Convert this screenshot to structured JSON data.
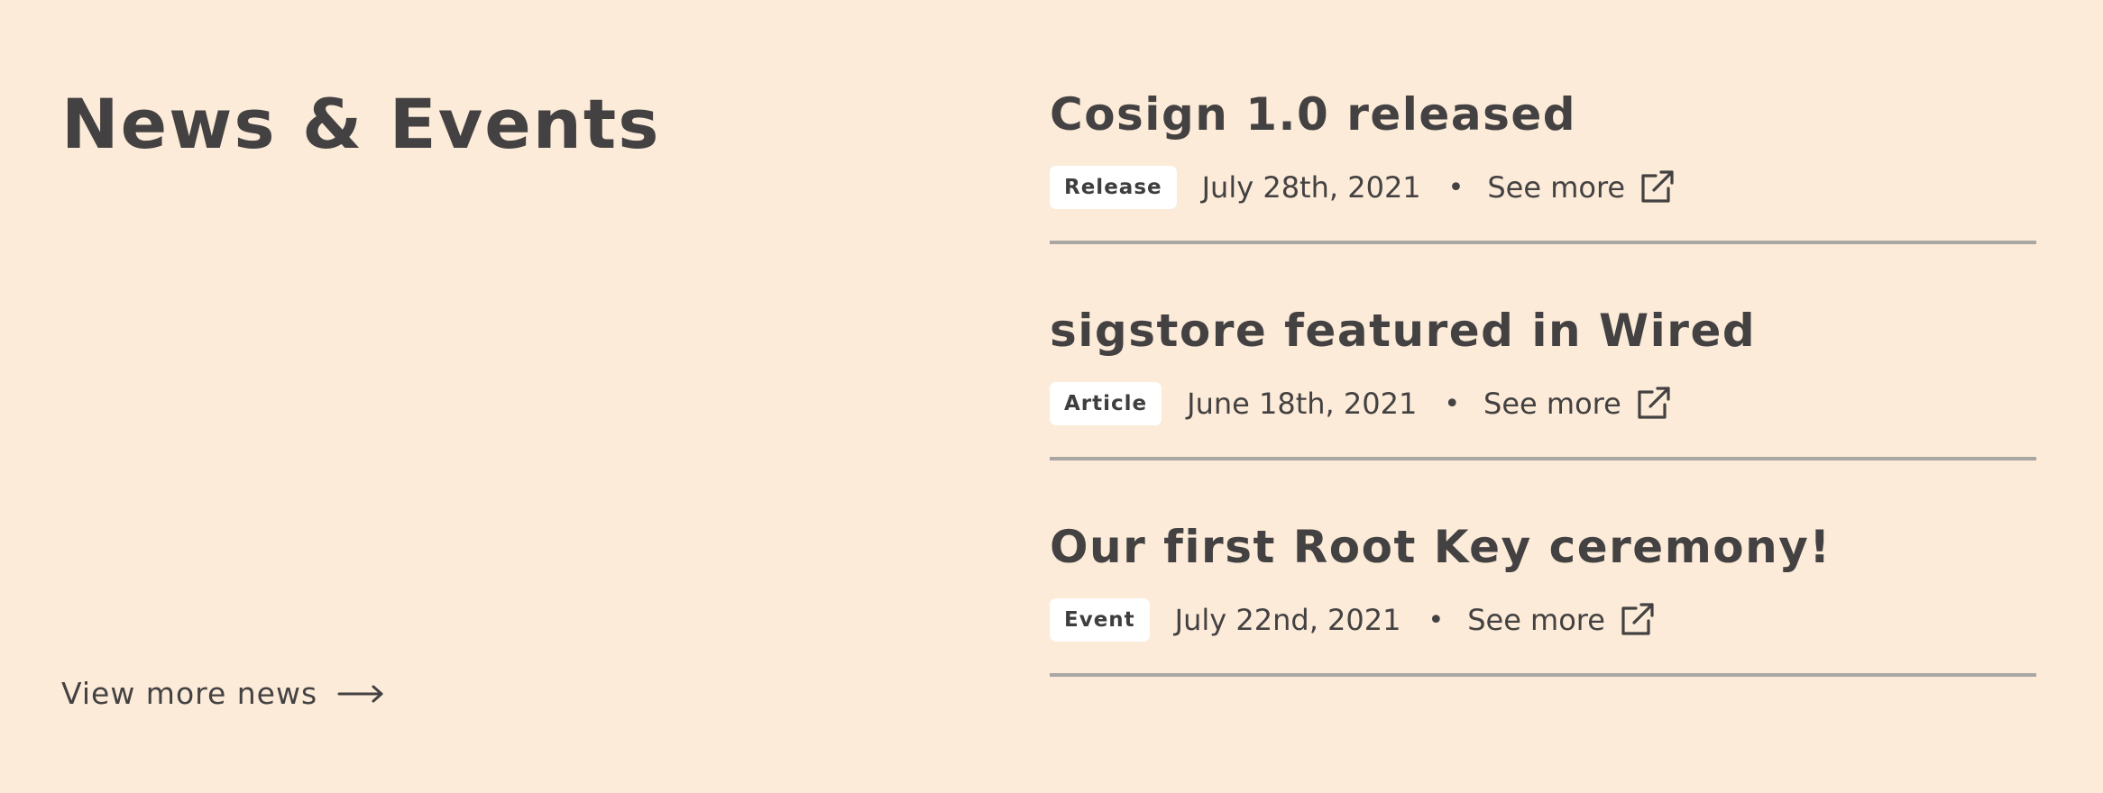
{
  "section": {
    "title": "News & Events",
    "view_more_label": "View more news"
  },
  "news": [
    {
      "title": "Cosign 1.0 released",
      "tag": "Release",
      "date": "July 28th, 2021",
      "separator": "•",
      "link_label": "See more"
    },
    {
      "title": "sigstore featured in Wired",
      "tag": "Article",
      "date": "June 18th, 2021",
      "separator": "•",
      "link_label": "See more"
    },
    {
      "title": "Our first Root Key ceremony!",
      "tag": "Event",
      "date": "July 22nd, 2021",
      "separator": "•",
      "link_label": "See more"
    }
  ],
  "icons": {
    "view_more": "arrow-right-icon",
    "see_more": "external-link-icon"
  },
  "colors": {
    "background": "#FBEBD8",
    "text": "#444142",
    "tag_background": "#FFFFFF",
    "divider": "#A9A6A4"
  }
}
